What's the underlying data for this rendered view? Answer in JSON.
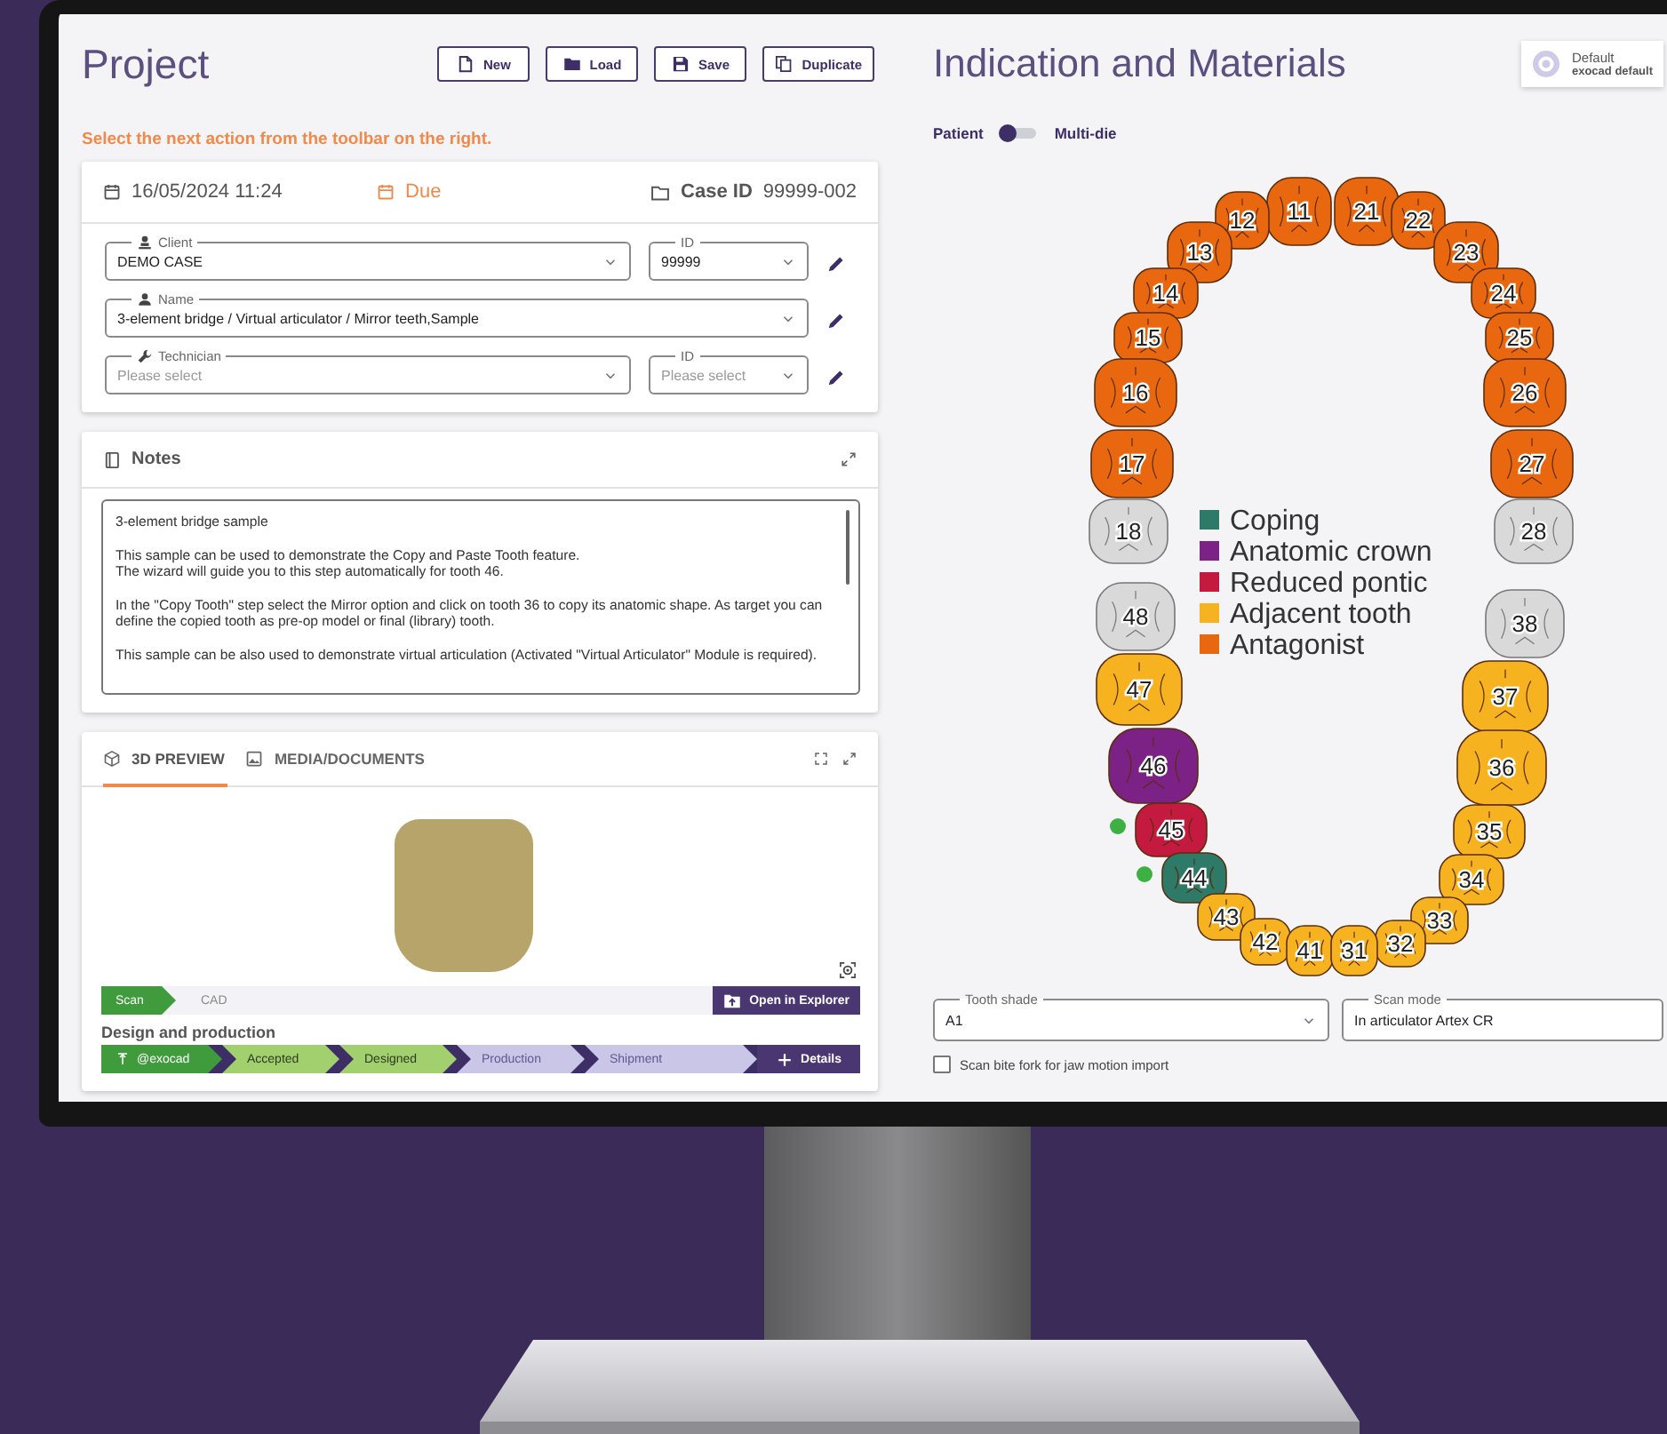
{
  "project": {
    "title": "Project",
    "toolbar": [
      {
        "label": "New"
      },
      {
        "label": "Load"
      },
      {
        "label": "Save"
      },
      {
        "label": "Duplicate"
      }
    ],
    "hint": "Select the next action from the toolbar on the right.",
    "case_card": {
      "date": "16/05/2024 11:24",
      "due": "Due",
      "case_id_label": "Case ID",
      "case_id": "99999-002",
      "fields": [
        {
          "label": "Client",
          "value": "DEMO CASE",
          "id": {
            "label": "ID",
            "value": "99999"
          }
        },
        {
          "label": "Name",
          "value": "3-element bridge / Virtual articulator / Mirror teeth,Sample"
        },
        {
          "label": "Technician",
          "placeholder": "Please select",
          "id": {
            "label": "ID",
            "placeholder": "Please select"
          }
        }
      ]
    },
    "notes": {
      "title": "Notes",
      "paragraphs": [
        "3-element bridge sample",
        "This sample can be used to demonstrate the Copy and Paste Tooth feature.\nThe wizard will guide you to this step automatically for tooth 46.",
        "In the \"Copy Tooth\" step select the Mirror option and click on tooth 36 to copy its anatomic shape. As target you can define the copied tooth as pre-op model or final (library) tooth.",
        "This sample can be also used to demonstrate virtual articulation (Activated \"Virtual Articulator\" Module is required)."
      ]
    },
    "preview": {
      "tabs": [
        {
          "label": "3D PREVIEW",
          "selected": true
        },
        {
          "label": "MEDIA/DOCUMENTS",
          "selected": false
        }
      ],
      "scan_steps": [
        {
          "label": "Scan",
          "done": true,
          "current": true
        },
        {
          "label": "CAD",
          "done": false,
          "current": false
        }
      ],
      "open_button": "Open in Explorer",
      "production_title": "Design and production",
      "production_steps": [
        {
          "label": "@exocad",
          "done": true,
          "current": true
        },
        {
          "label": "Accepted",
          "done": true,
          "current": false
        },
        {
          "label": "Designed",
          "done": true,
          "current": false
        },
        {
          "label": "Production",
          "done": false,
          "current": false
        },
        {
          "label": "Shipment",
          "done": false,
          "current": false
        }
      ],
      "details_button": "Details"
    }
  },
  "indication": {
    "title": "Indication and Materials",
    "profile": {
      "title": "Default",
      "subtitle": "exocad default"
    },
    "mode_toggle": {
      "left": "Patient",
      "right": "Multi-die",
      "on": false
    },
    "teeth": [
      {
        "number": "11",
        "color": "#e8670f",
        "marked": false
      },
      {
        "number": "12",
        "color": "#e8670f",
        "marked": false
      },
      {
        "number": "13",
        "color": "#e8670f",
        "marked": false
      },
      {
        "number": "14",
        "color": "#e8670f",
        "marked": false
      },
      {
        "number": "15",
        "color": "#e8670f",
        "marked": false
      },
      {
        "number": "16",
        "color": "#e8670f",
        "marked": false
      },
      {
        "number": "17",
        "color": "#e8670f",
        "marked": false
      },
      {
        "number": "18",
        "color": "#d9d9d9",
        "marked": false
      },
      {
        "number": "21",
        "color": "#e8670f",
        "marked": false
      },
      {
        "number": "22",
        "color": "#e8670f",
        "marked": false
      },
      {
        "number": "23",
        "color": "#e8670f",
        "marked": false
      },
      {
        "number": "24",
        "color": "#e8670f",
        "marked": false
      },
      {
        "number": "25",
        "color": "#e8670f",
        "marked": false
      },
      {
        "number": "26",
        "color": "#e8670f",
        "marked": false
      },
      {
        "number": "27",
        "color": "#e8670f",
        "marked": false
      },
      {
        "number": "28",
        "color": "#d9d9d9",
        "marked": false
      },
      {
        "number": "48",
        "color": "#d9d9d9",
        "marked": false
      },
      {
        "number": "47",
        "color": "#f6b31f",
        "marked": false
      },
      {
        "number": "46",
        "color": "#7c2186",
        "marked": false
      },
      {
        "number": "45",
        "color": "#c41a40",
        "marked": true
      },
      {
        "number": "44",
        "color": "#2e7a68",
        "marked": true
      },
      {
        "number": "43",
        "color": "#f6b31f",
        "marked": false
      },
      {
        "number": "42",
        "color": "#f6b31f",
        "marked": false
      },
      {
        "number": "41",
        "color": "#f6b31f",
        "marked": false
      },
      {
        "number": "38",
        "color": "#d9d9d9",
        "marked": false
      },
      {
        "number": "37",
        "color": "#f6b31f",
        "marked": false
      },
      {
        "number": "36",
        "color": "#f6b31f",
        "marked": false
      },
      {
        "number": "35",
        "color": "#f6b31f",
        "marked": false
      },
      {
        "number": "34",
        "color": "#f6b31f",
        "marked": false
      },
      {
        "number": "33",
        "color": "#f6b31f",
        "marked": false
      },
      {
        "number": "32",
        "color": "#f6b31f",
        "marked": false
      },
      {
        "number": "31",
        "color": "#f6b31f",
        "marked": false
      }
    ],
    "legend": [
      {
        "label": "Coping",
        "color": "#2e7a68"
      },
      {
        "label": "Anatomic crown",
        "color": "#7c2186"
      },
      {
        "label": "Reduced pontic",
        "color": "#c41a40"
      },
      {
        "label": "Adjacent tooth",
        "color": "#f6b31f"
      },
      {
        "label": "Antagonist",
        "color": "#e8670f"
      }
    ],
    "tooth_shade": {
      "label": "Tooth shade",
      "value": "A1"
    },
    "scan_mode": {
      "label": "Scan mode",
      "value": "In articulator Artex CR"
    },
    "bite_fork": {
      "label": "Scan bite fork for jaw motion import",
      "checked": false
    }
  }
}
